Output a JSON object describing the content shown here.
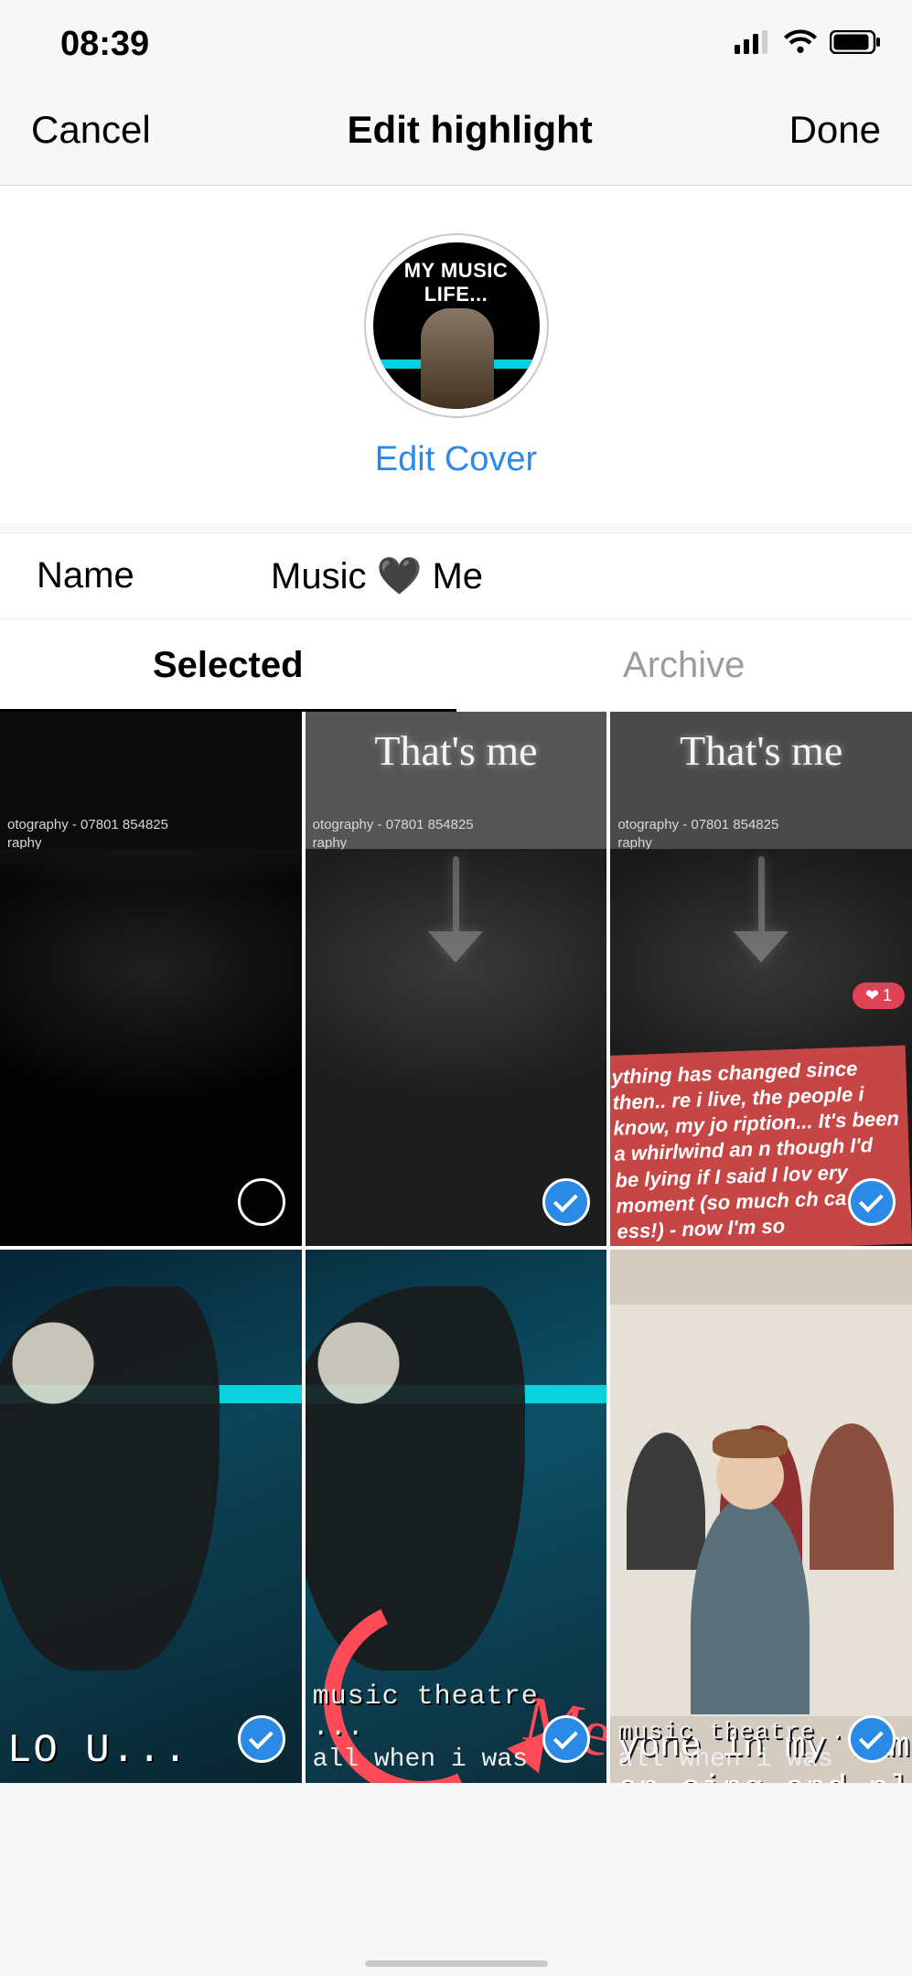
{
  "status": {
    "time": "08:39"
  },
  "nav": {
    "cancel": "Cancel",
    "title": "Edit highlight",
    "done": "Done"
  },
  "cover": {
    "inner_text": "MY MUSIC LIFE...",
    "edit_link": "Edit Cover"
  },
  "name_field": {
    "label": "Name",
    "value": "Music 🖤 Me"
  },
  "tabs": {
    "selected": "Selected",
    "archive": "Archive",
    "active": "selected"
  },
  "colors": {
    "accent": "#2a8ae6",
    "heart_badge": "#e04154",
    "swoosh": "#ff4a57",
    "cyan": "#0bd0de"
  },
  "grid": [
    {
      "id": "cell-1",
      "selected": false,
      "watermark": {
        "line1": "otography - 07801 854825",
        "line2": "raphy"
      }
    },
    {
      "id": "cell-2",
      "selected": true,
      "cursive": "That's me",
      "watermark": {
        "line1": "otography - 07801 854825",
        "line2": "raphy"
      }
    },
    {
      "id": "cell-3",
      "selected": true,
      "cursive": "That's me",
      "watermark": {
        "line1": "otography - 07801 854825",
        "line2": "raphy"
      },
      "heart_count": "1",
      "red_caption": "ything has changed since then.. re i live, the people i know, my jo ription... It's been a whirlwind an n though I'd be lying if I said I lov ery moment (so much ch        ca ---ess!) - now I'm so"
    },
    {
      "id": "cell-4",
      "selected": true,
      "bottom_line": "LO U..."
    },
    {
      "id": "cell-5",
      "selected": true,
      "me_text": "Me",
      "bottom": {
        "line1": "music theatre ...",
        "line2": "all when i was"
      }
    },
    {
      "id": "cell-6",
      "selected": true,
      "family_caption": "yone in my fam\nan sing and pla",
      "bottom": {
        "line1": "music theatre ...",
        "line2": "all when i was"
      }
    }
  ]
}
